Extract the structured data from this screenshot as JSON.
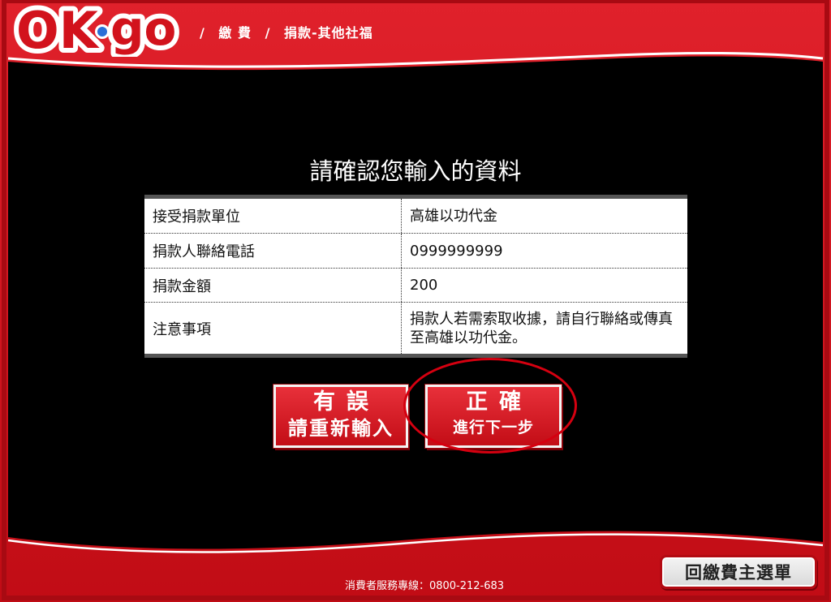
{
  "header": {
    "logo_text": "OK·go",
    "breadcrumb": [
      "/",
      "繳 費",
      "/",
      "捐款-其他社福"
    ]
  },
  "main": {
    "title": "請確認您輸入的資料",
    "rows": [
      {
        "label": "接受捐款單位",
        "value": "高雄以功代金"
      },
      {
        "label": "捐款人聯絡電話",
        "value": "0999999999"
      },
      {
        "label": "捐款金額",
        "value": "200"
      },
      {
        "label": "注意事項",
        "value": "捐款人若需索取收據，請自行聯絡或傳真至高雄以功代金。"
      }
    ],
    "button_wrong": {
      "line1": "有誤",
      "line2": "請重新輸入"
    },
    "button_correct": {
      "line1": "正確",
      "line2": "進行下一步"
    }
  },
  "footer": {
    "hotline": "消費者服務專線：0800-212-683",
    "home_button": "回繳費主選單"
  },
  "colors": {
    "brand_red": "#d2121c",
    "screen_black": "#000000",
    "annotation_circle": "#d50010"
  }
}
